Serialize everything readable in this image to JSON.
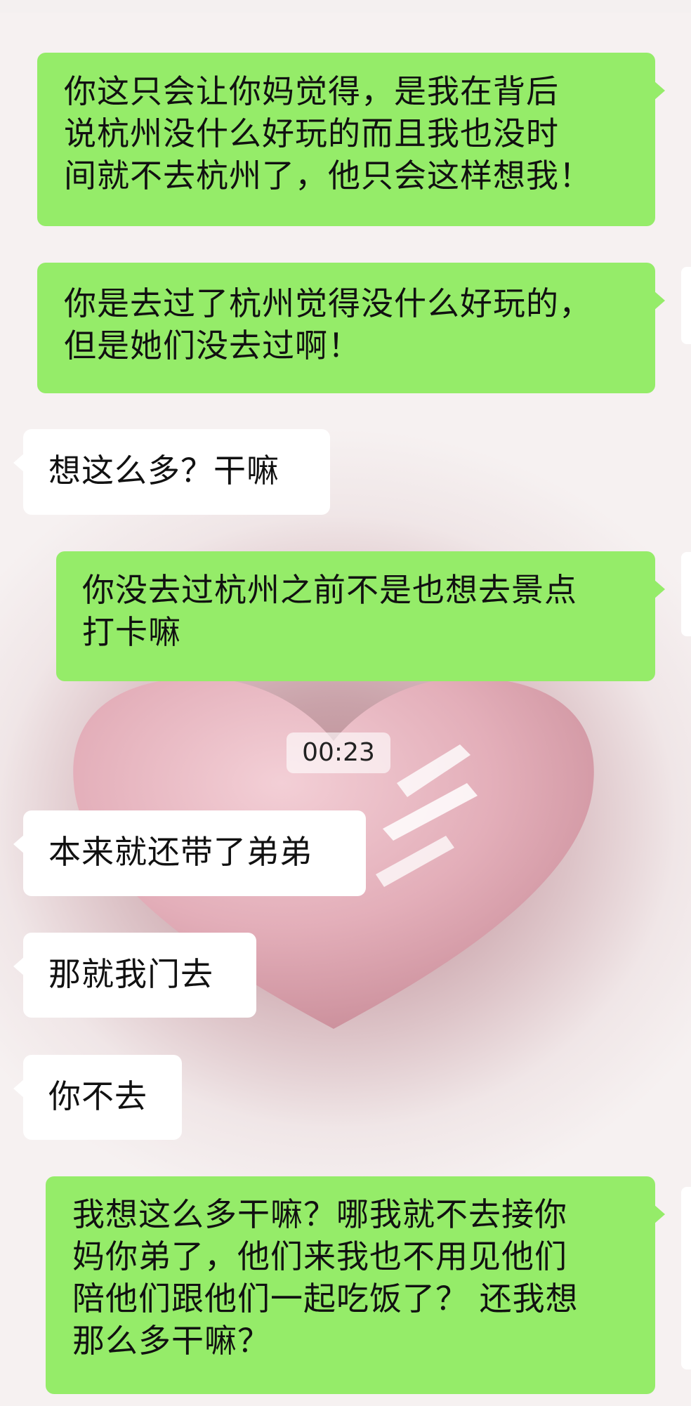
{
  "chat": {
    "messages": [
      {
        "from": "me",
        "text": "你这只会让你妈觉得，是我在背后\n说杭州没什么好玩的而且我也没时\n间就不去杭州了，他只会这样想我！"
      },
      {
        "from": "me",
        "text": "你是去过了杭州觉得没什么好玩的，\n但是她们没去过啊！"
      },
      {
        "from": "other",
        "text": "想这么多？干嘛"
      },
      {
        "from": "me",
        "text": "你没去过杭州之前不是也想去景点\n打卡嘛"
      },
      {
        "from": "other",
        "text": "本来就还带了弟弟"
      },
      {
        "from": "other",
        "text": "那就我门去"
      },
      {
        "from": "other",
        "text": "你不去"
      },
      {
        "from": "me",
        "text": "我想这么多干嘛？哪我就不去接你\n妈你弟了，他们来我也不用见他们\n陪他们跟他们一起吃饭了？ 还我想\n那么多干嘛？"
      }
    ],
    "timestamp": "00:23"
  },
  "colors": {
    "outgoing_bubble": "#95ec69",
    "incoming_bubble": "#ffffff",
    "background_heart": "#e8b8c2"
  }
}
